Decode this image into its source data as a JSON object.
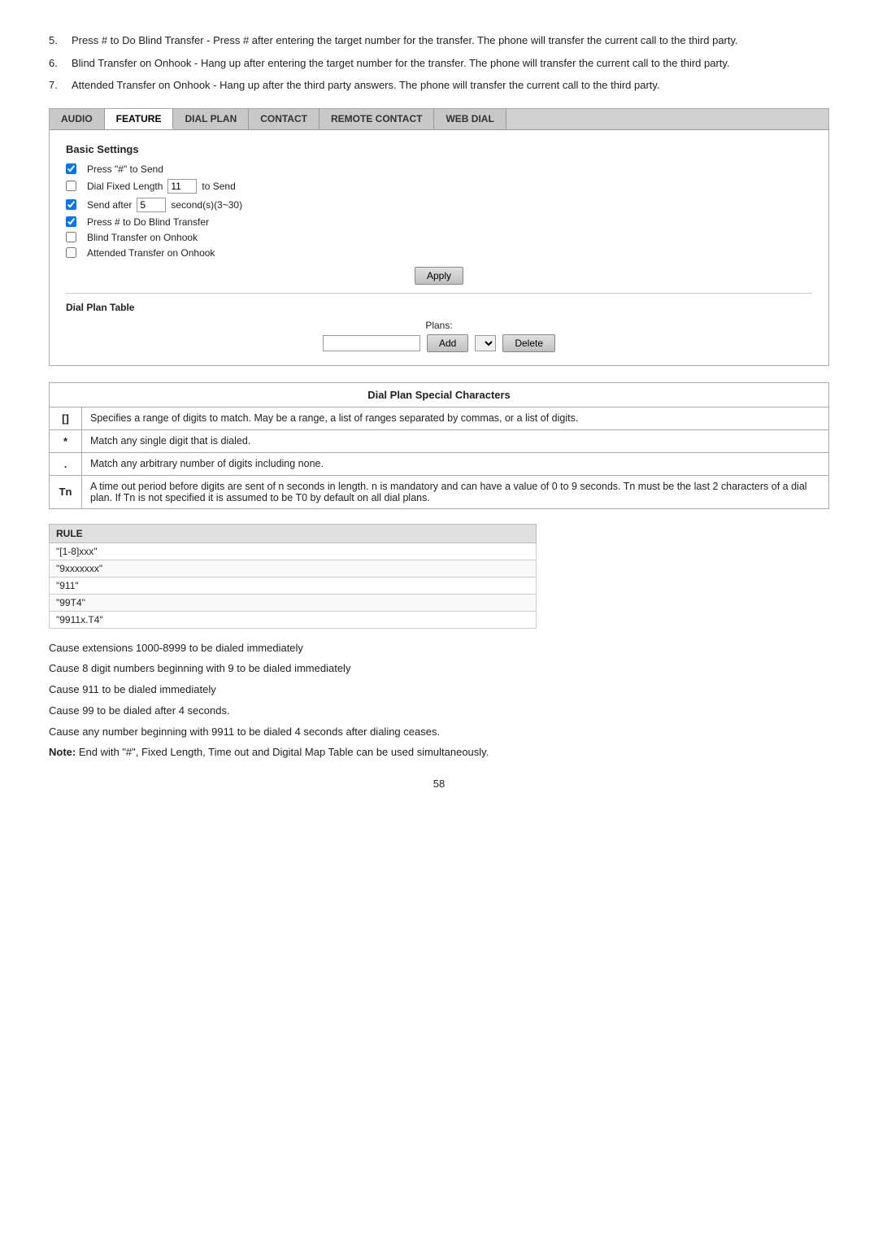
{
  "bullets": [
    {
      "num": "5.",
      "text": "Press # to Do Blind Transfer - Press # after entering the target number for the transfer. The phone will transfer the current call to the third party."
    },
    {
      "num": "6.",
      "text": "Blind Transfer on Onhook - Hang up after entering the target number for the transfer. The phone will transfer the current call to the third party."
    },
    {
      "num": "7.",
      "text": "Attended Transfer on Onhook - Hang up after the third party answers. The phone will transfer the current call to the third party."
    }
  ],
  "tabs": [
    {
      "label": "AUDIO",
      "active": false
    },
    {
      "label": "FEATURE",
      "active": false
    },
    {
      "label": "DIAL PLAN",
      "active": true
    },
    {
      "label": "CONTACT",
      "active": false
    },
    {
      "label": "REMOTE CONTACT",
      "active": false
    },
    {
      "label": "WEB DIAL",
      "active": false
    }
  ],
  "basic_settings": {
    "title": "Basic Settings",
    "rows": [
      {
        "checked": true,
        "label": "Press \"#\" to Send",
        "extra": ""
      },
      {
        "checked": false,
        "label": "Dial Fixed Length",
        "input": "11",
        "after": "to Send"
      },
      {
        "checked": true,
        "label": "Send after",
        "input": "5",
        "after": "second(s)(3~30)"
      },
      {
        "checked": true,
        "label": "Press # to Do Blind Transfer",
        "extra": ""
      },
      {
        "checked": false,
        "label": "Blind Transfer on Onhook",
        "extra": ""
      },
      {
        "checked": false,
        "label": "Attended Transfer on Onhook",
        "extra": ""
      }
    ],
    "apply_label": "Apply"
  },
  "dial_plan_table": {
    "title": "Dial Plan Table",
    "plans_label": "Plans:",
    "add_label": "Add",
    "delete_label": "Delete"
  },
  "special_chars": {
    "title": "Dial Plan Special Characters",
    "rows": [
      {
        "char": "[]",
        "desc": "Specifies a range of digits to match. May be a range, a list of ranges separated by commas, or a list of digits."
      },
      {
        "char": "*",
        "desc": "Match any single digit that is dialed."
      },
      {
        "char": ".",
        "desc": "Match any arbitrary number of digits including none."
      },
      {
        "char": "Tn",
        "desc": "A time out period before digits are sent of n seconds in length. n is mandatory and can have a value of 0 to 9 seconds. Tn must be the last 2 characters of a dial plan. If Tn is not specified it is assumed to be T0 by default on all dial plans."
      }
    ]
  },
  "rules_table": {
    "header": "RULE",
    "rows": [
      "\"[1-8]xxx\"",
      "\"9xxxxxxx\"",
      "\"911\"",
      "\"99T4\"",
      "\"9911x.T4\""
    ]
  },
  "descriptions": [
    "Cause extensions 1000-8999 to be dialed immediately",
    "Cause 8 digit numbers beginning with 9 to be dialed immediately",
    "Cause 911 to be dialed immediately",
    "Cause 99 to be dialed after 4 seconds.",
    "Cause any number beginning with 9911 to be dialed 4 seconds after dialing ceases.",
    {
      "bold_prefix": "Note:",
      "text": " End with \"#\", Fixed Length, Time out and Digital Map Table can be used simultaneously."
    }
  ],
  "page_number": "58"
}
